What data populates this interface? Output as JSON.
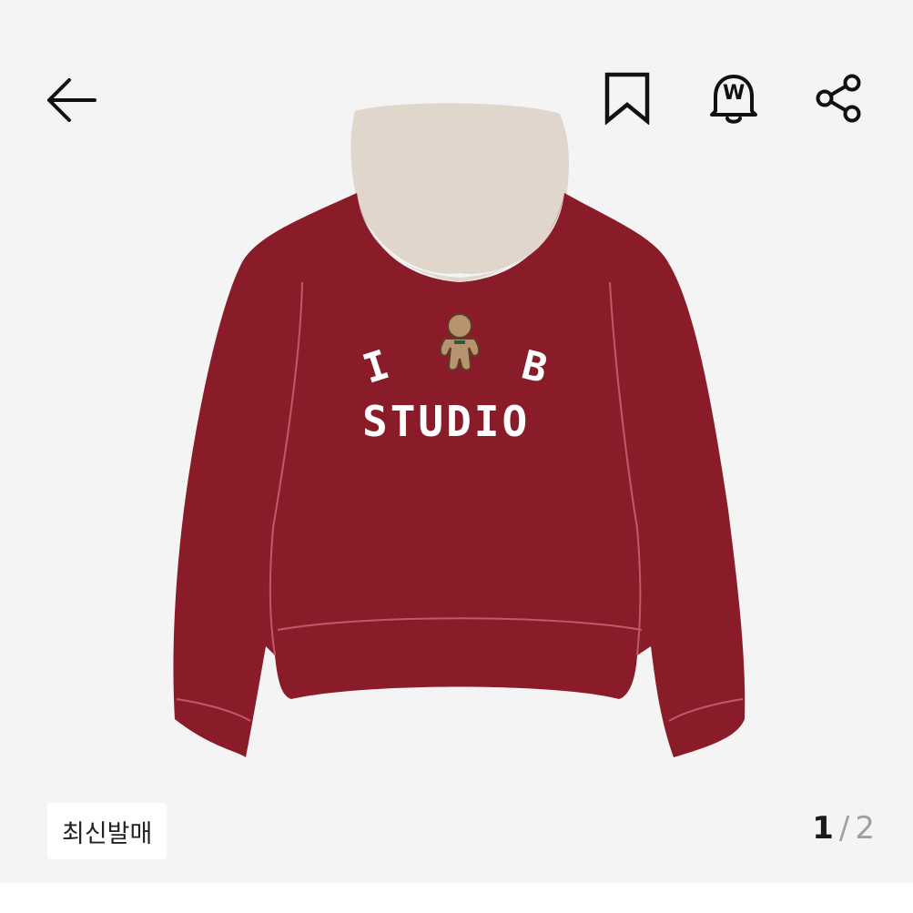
{
  "header": {
    "back_icon": "arrow-left-icon",
    "bookmark_icon": "bookmark-icon",
    "price_alert_icon": "bell-won-icon",
    "price_alert_symbol": "W",
    "share_icon": "share-icon"
  },
  "product": {
    "print_top_left": "I",
    "print_top_right": "B",
    "print_bottom": "STUDIO",
    "colors": {
      "body": "#8a1c2a",
      "hood_lining": "#e0d6cc",
      "print": "#ffffff",
      "mascot": "#b8946e"
    }
  },
  "badge": {
    "label": "최신발매"
  },
  "pager": {
    "current": "1",
    "separator": "/",
    "total": "2"
  }
}
